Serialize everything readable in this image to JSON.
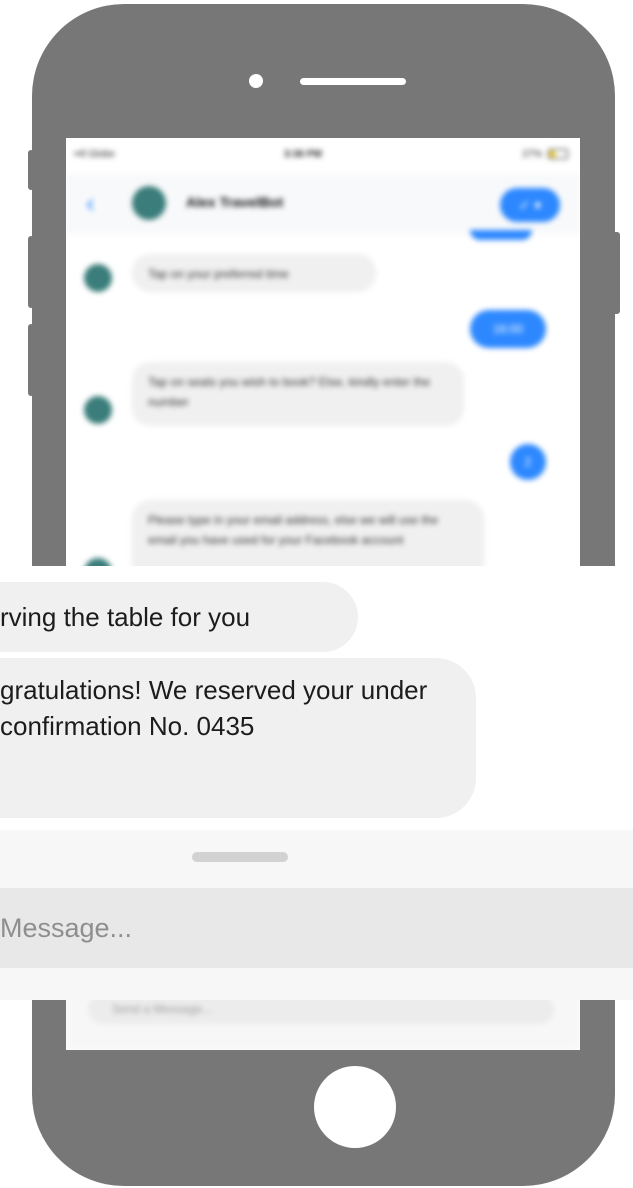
{
  "status_bar": {
    "carrier": "••ll Globe",
    "time": "3:36 PM",
    "battery": "27%"
  },
  "chat_header": {
    "bot_name": "Alex TravelBot",
    "back_icon": "chevron-left-icon",
    "action_label": "✓ ▾"
  },
  "messages": {
    "bot_time_prompt": "Tap on your preferred time",
    "user_time": "16:00",
    "bot_seats_prompt": "Tap on seats you wish to book? Else, kindly enter the number",
    "user_seats": "2",
    "bot_email_prompt": "Please type in your email address, else we will use the email you have used for your Facebook account"
  },
  "screen_input": {
    "placeholder": "Send a Message..."
  },
  "zoom": {
    "bubble_1": "rving the table for you",
    "bubble_2": "gratulations! We reserved your under confirmation No. 0435",
    "input_placeholder": "Message..."
  },
  "colors": {
    "phone_body": "#777777",
    "accent_blue": "#2d88ff",
    "bubble_gray": "#f0f0f0"
  }
}
